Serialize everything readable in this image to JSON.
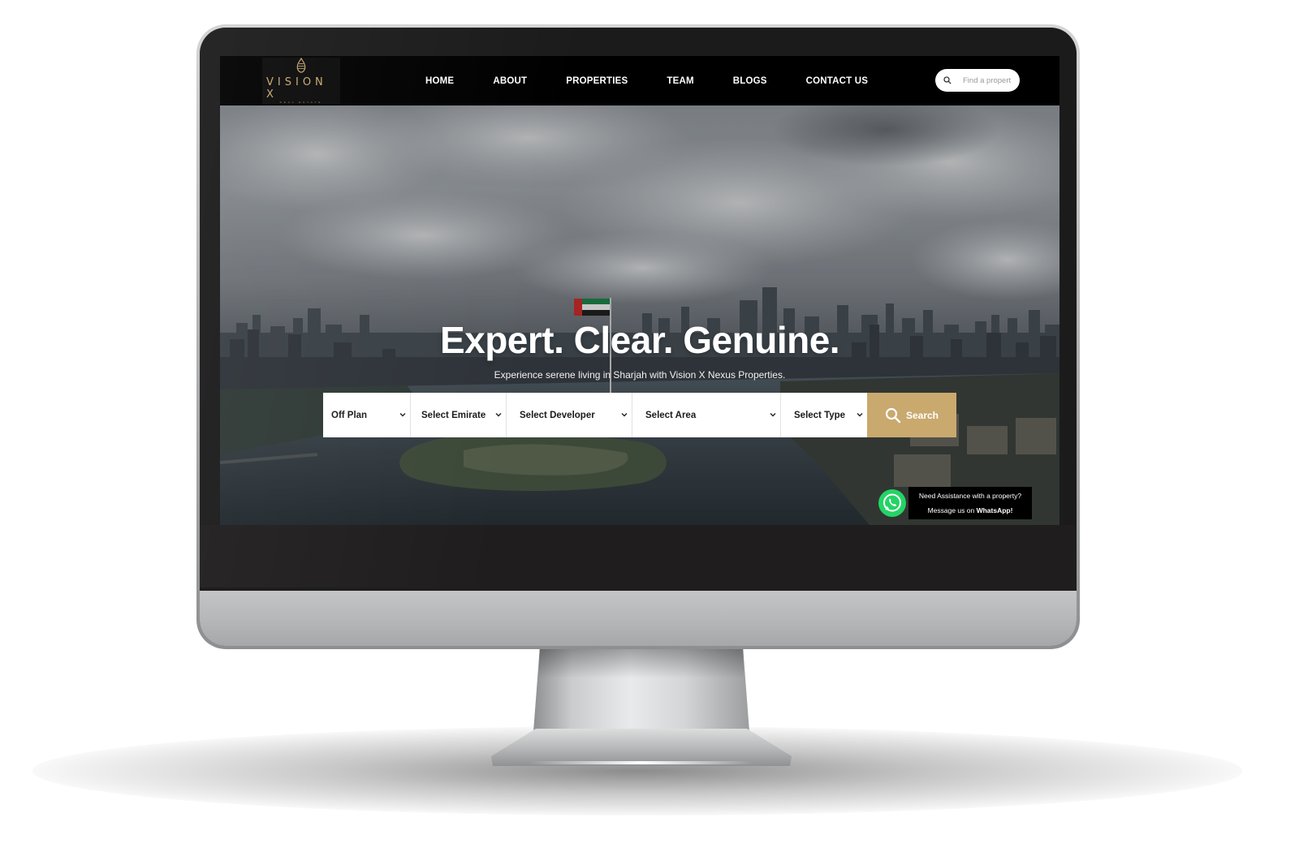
{
  "brand": {
    "name": "VISION X",
    "tagline": "REAL ESTATE"
  },
  "nav": {
    "items": [
      {
        "label": "HOME"
      },
      {
        "label": "ABOUT"
      },
      {
        "label": "PROPERTIES"
      },
      {
        "label": "TEAM"
      },
      {
        "label": "BLOGS"
      },
      {
        "label": "CONTACT US"
      }
    ],
    "search_placeholder": "Find a propert"
  },
  "hero": {
    "headline": "Expert. Clear. Genuine.",
    "subhead": "Experience serene living in Sharjah with Vision X Nexus Properties."
  },
  "search": {
    "filters": [
      {
        "label": "Off Plan"
      },
      {
        "label": "Select Emirate"
      },
      {
        "label": "Select Developer"
      },
      {
        "label": "Select Area"
      },
      {
        "label": "Select Type"
      }
    ],
    "button_label": "Search"
  },
  "whatsapp": {
    "line1": "Need Assistance with a property?",
    "line2_prefix": "Message us on ",
    "line2_bold": "WhatsApp!"
  },
  "colors": {
    "accent_gold": "#c9a96e",
    "navbar_bg": "#000000",
    "whatsapp_green": "#25d366"
  }
}
